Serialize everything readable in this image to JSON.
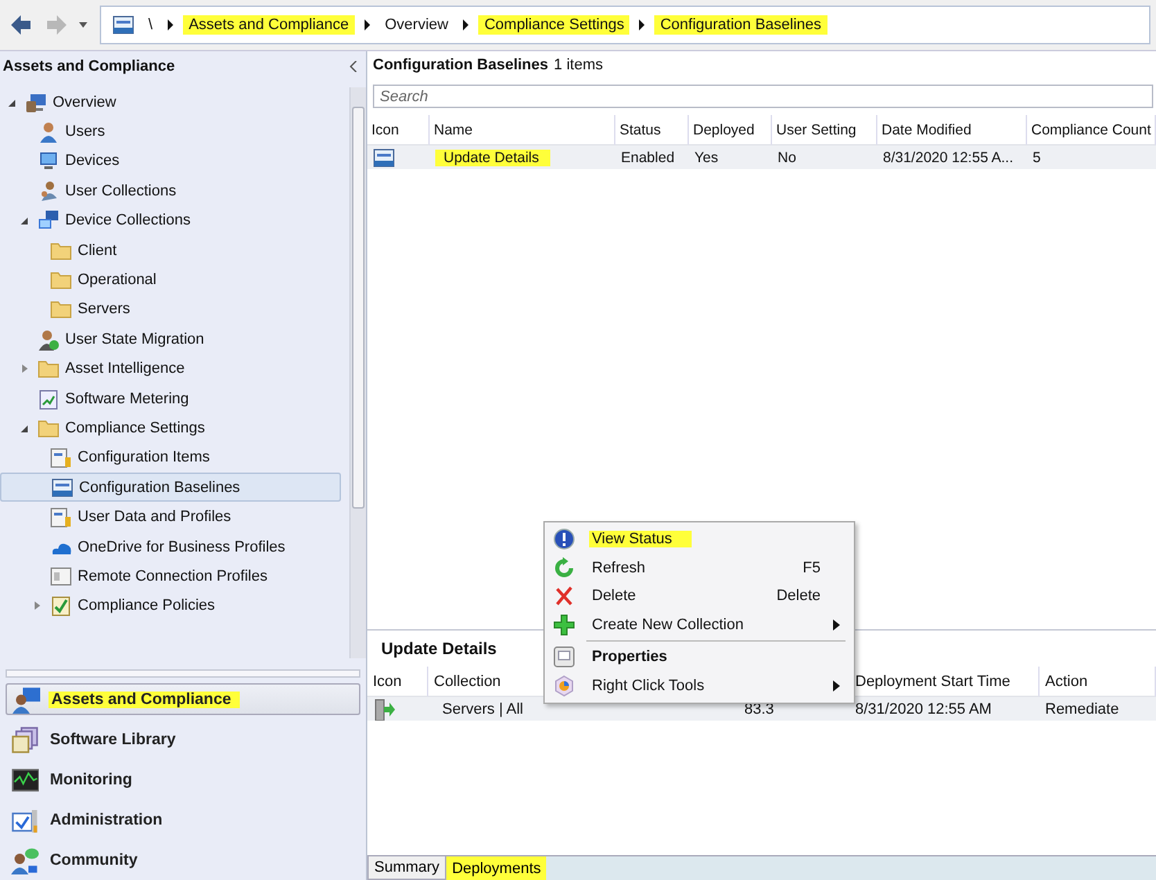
{
  "navigation": {
    "back_disabled": false,
    "forward_disabled": true
  },
  "breadcrumb": [
    {
      "text": "\\",
      "highlighted": false
    },
    {
      "text": "Assets and Compliance",
      "highlighted": true
    },
    {
      "text": "Overview",
      "highlighted": false
    },
    {
      "text": "Compliance Settings",
      "highlighted": true
    },
    {
      "text": "Configuration Baselines",
      "highlighted": true
    }
  ],
  "sidebar": {
    "title": "Assets and Compliance",
    "tree": [
      {
        "label": "Overview",
        "expanded": true,
        "selected": false,
        "children": [
          {
            "label": "Users",
            "selected": false
          },
          {
            "label": "Devices",
            "selected": false
          },
          {
            "label": "User Collections",
            "selected": false
          },
          {
            "label": "Device Collections",
            "expanded": true,
            "selected": false,
            "children": [
              {
                "label": "Client",
                "selected": false
              },
              {
                "label": "Operational",
                "selected": false
              },
              {
                "label": "Servers",
                "selected": false
              }
            ]
          },
          {
            "label": "User State Migration",
            "selected": false
          },
          {
            "label": "Asset Intelligence",
            "expanded": false,
            "selected": false
          },
          {
            "label": "Software Metering",
            "selected": false
          },
          {
            "label": "Compliance Settings",
            "expanded": true,
            "selected": false,
            "children": [
              {
                "label": "Configuration Items",
                "selected": false
              },
              {
                "label": "Configuration Baselines",
                "selected": true
              },
              {
                "label": "User Data and Profiles",
                "selected": false
              },
              {
                "label": "OneDrive for Business Profiles",
                "selected": false
              },
              {
                "label": "Remote Connection Profiles",
                "selected": false
              },
              {
                "label": "Compliance Policies",
                "expanded": false,
                "selected": false
              }
            ]
          }
        ]
      }
    ],
    "workspaces": [
      {
        "label": "Assets and Compliance",
        "selected": true,
        "highlighted": true
      },
      {
        "label": "Software Library",
        "selected": false,
        "highlighted": false
      },
      {
        "label": "Monitoring",
        "selected": false,
        "highlighted": false
      },
      {
        "label": "Administration",
        "selected": false,
        "highlighted": false
      },
      {
        "label": "Community",
        "selected": false,
        "highlighted": false
      }
    ]
  },
  "list": {
    "title": "Configuration Baselines",
    "count": "1 items",
    "search": {
      "placeholder": "Search"
    },
    "columns": [
      "Icon",
      "Name",
      "Status",
      "Deployed",
      "User Setting",
      "Date Modified",
      "Compliance Count"
    ],
    "rows": [
      {
        "name_highlighted": true,
        "cells": [
          "",
          "Update Details",
          "Enabled",
          "Yes",
          "No",
          "8/31/2020 12:55 A...",
          "5"
        ]
      }
    ]
  },
  "details": {
    "title": "Update Details",
    "columns": [
      "Icon",
      "Collection",
      null,
      "Deployment Start Time",
      "Action"
    ],
    "rows": [
      {
        "cells": [
          "",
          "Servers | All",
          "83.3",
          "8/31/2020 12:55 AM",
          "Remediate"
        ]
      }
    ],
    "tabs": [
      {
        "label": "Summary",
        "selected": false,
        "highlighted": false
      },
      {
        "label": "Deployments",
        "selected": true,
        "highlighted": true
      }
    ]
  },
  "context_menu": [
    {
      "kind": "item",
      "label": "View Status",
      "highlighted": true,
      "default": false,
      "submenu": false
    },
    {
      "kind": "item",
      "label": "Refresh",
      "shortcut": "F5",
      "highlighted": false,
      "default": false,
      "submenu": false
    },
    {
      "kind": "item",
      "label": "Delete",
      "shortcut": "Delete",
      "highlighted": false,
      "default": false,
      "submenu": false
    },
    {
      "kind": "item",
      "label": "Create New Collection",
      "highlighted": false,
      "default": false,
      "submenu": true
    },
    {
      "kind": "separator"
    },
    {
      "kind": "item",
      "label": "Properties",
      "highlighted": false,
      "default": true,
      "submenu": false
    },
    {
      "kind": "item",
      "label": "Right Click Tools",
      "highlighted": false,
      "default": false,
      "submenu": true
    }
  ]
}
